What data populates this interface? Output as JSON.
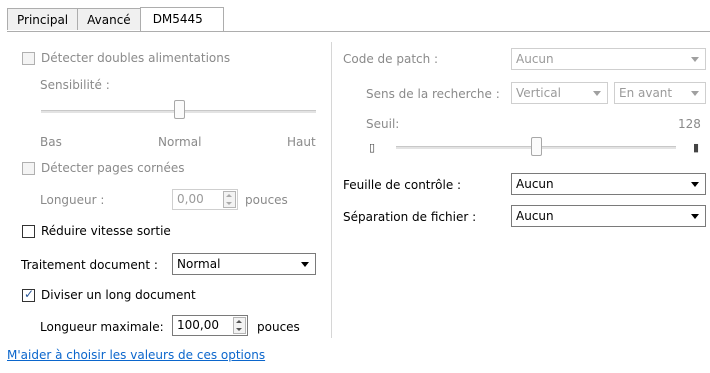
{
  "tabs": [
    "Principal",
    "Avancé",
    "DM5445"
  ],
  "left": {
    "detect_double": "Détecter doubles alimentations",
    "sensitivity_label": "Sensibilité :",
    "sens_low": "Bas",
    "sens_mid": "Normal",
    "sens_high": "Haut",
    "sensitivity_level": 0.5,
    "detect_folded": "Détecter pages cornées",
    "length_label": "Longueur :",
    "length_value": "0,00",
    "length_unit": "pouces",
    "reduce_speed": "Réduire vitesse sortie",
    "doc_treatment_label": "Traitement document :",
    "doc_treatment_value": "Normal",
    "split_long": "Diviser un long document",
    "split_long_checked": true,
    "max_length_label": "Longueur maximale:",
    "max_length_value": "100,00",
    "max_length_unit": "pouces",
    "help_link": "M'aider à choisir les valeurs de ces options"
  },
  "right": {
    "patch_code_label": "Code de patch :",
    "patch_code_value": "Aucun",
    "search_dir_label": "Sens de la recherche :",
    "search_dir_value": "Vertical",
    "search_order_value": "En avant",
    "threshold_label": "Seuil:",
    "threshold_value": "128",
    "threshold_level": 0.5,
    "control_sheet_label": "Feuille de contrôle :",
    "control_sheet_value": "Aucun",
    "file_sep_label": "Séparation de fichier :",
    "file_sep_value": "Aucun"
  }
}
